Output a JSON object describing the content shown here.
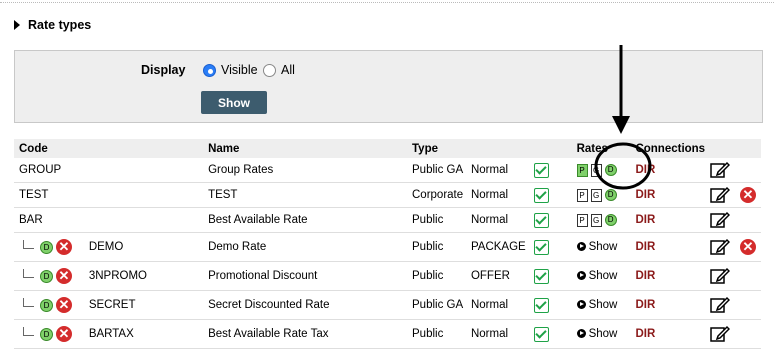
{
  "section": {
    "title": "Rate types"
  },
  "filter": {
    "display_label": "Display",
    "options": [
      "Visible",
      "All"
    ],
    "selected": "Visible",
    "show_button": "Show"
  },
  "table": {
    "headers": [
      "Code",
      "",
      "Name",
      "Type",
      "",
      "",
      "Rates",
      "Connections",
      "",
      ""
    ],
    "rows": [
      {
        "code": "GROUP",
        "sub": "",
        "name": "Group Rates",
        "type": "Public GA",
        "kind": "Normal",
        "rates": [
          "P",
          "G",
          "D"
        ],
        "rates_show": "",
        "conn": "DIR",
        "deletable": false,
        "child": false
      },
      {
        "code": "TEST",
        "sub": "",
        "name": "TEST",
        "type": "Corporate",
        "kind": "Normal",
        "rates": [
          "P",
          "G",
          "D"
        ],
        "rates_show": "",
        "conn": "DIR",
        "deletable": true,
        "child": false
      },
      {
        "code": "BAR",
        "sub": "",
        "name": "Best Available Rate",
        "type": "Public",
        "kind": "Normal",
        "rates": [
          "P",
          "G",
          "D"
        ],
        "rates_show": "",
        "conn": "DIR",
        "deletable": false,
        "child": false
      },
      {
        "code": "",
        "sub": "DEMO",
        "name": "Demo Rate",
        "type": "Public",
        "kind": "PACKAGE",
        "rates": [],
        "rates_show": "Show",
        "conn": "DIR",
        "deletable": true,
        "child": true
      },
      {
        "code": "",
        "sub": "3NPROMO",
        "name": "Promotional Discount",
        "type": "Public",
        "kind": "OFFER",
        "rates": [],
        "rates_show": "Show",
        "conn": "DIR",
        "deletable": false,
        "child": true
      },
      {
        "code": "",
        "sub": "SECRET",
        "name": "Secret Discounted Rate",
        "type": "Public GA",
        "kind": "Normal",
        "rates": [],
        "rates_show": "Show",
        "conn": "DIR",
        "deletable": false,
        "child": true
      },
      {
        "code": "",
        "sub": "BARTAX",
        "name": "Best Available Rate Tax",
        "type": "Public",
        "kind": "Normal",
        "rates": [],
        "rates_show": "Show",
        "conn": "DIR",
        "deletable": false,
        "child": true
      }
    ],
    "rate_badge_colors": {
      "P": "#7fd06a",
      "G": "#ffffff",
      "D": "#7fd06a"
    },
    "first_row_rate_colors": [
      "green",
      "white",
      "green"
    ]
  },
  "colors": {
    "check": "#1fa247",
    "dir": "#8b1a1a",
    "delete": "#d42c2c",
    "button": "#3d5c6e",
    "radio": "#2a7df6"
  }
}
